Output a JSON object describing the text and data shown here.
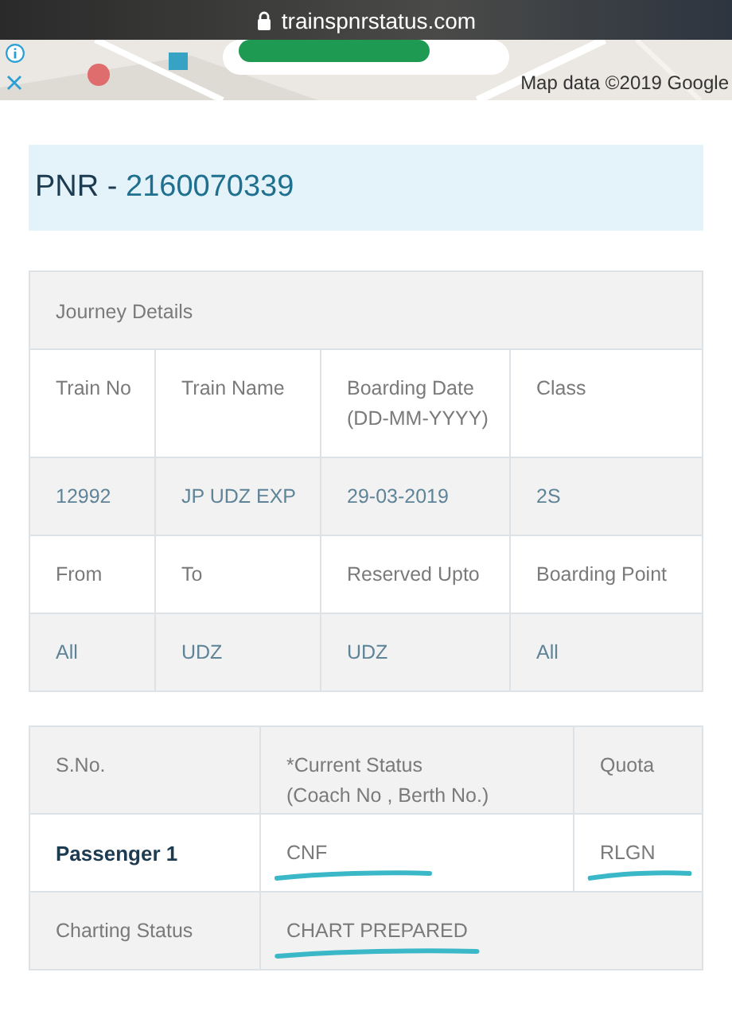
{
  "browser": {
    "url": "trainspnrstatus.com"
  },
  "ad": {
    "kind": "picture",
    "attribution": "Map data ©2019 Google"
  },
  "pnr": {
    "label": "PNR - ",
    "number": "2160070339"
  },
  "journey": {
    "title": "Journey Details",
    "rows": [
      {
        "kind": "head",
        "cells": [
          "Train No",
          "Train Name",
          "Boarding Date\n(DD-MM-YYYY)",
          "Class"
        ]
      },
      {
        "kind": "value",
        "cells": [
          "12992",
          "JP UDZ EXP",
          "29-03-2019",
          "2S"
        ]
      },
      {
        "kind": "head",
        "cells": [
          "From",
          "To",
          "Reserved Upto",
          "Boarding Point"
        ]
      },
      {
        "kind": "value",
        "cells": [
          "All",
          "UDZ",
          "UDZ",
          "All"
        ]
      }
    ]
  },
  "passengers": {
    "columns": [
      "S.No.",
      "*Current Status\n(Coach No , Berth No.)",
      "Quota"
    ],
    "rows": [
      {
        "name": "Passenger 1",
        "status": "CNF",
        "status_underlined": true,
        "quota": "RLGN",
        "quota_underlined": true
      }
    ],
    "charting": {
      "label": "Charting Status",
      "value": "CHART PREPARED",
      "underlined": true
    }
  }
}
